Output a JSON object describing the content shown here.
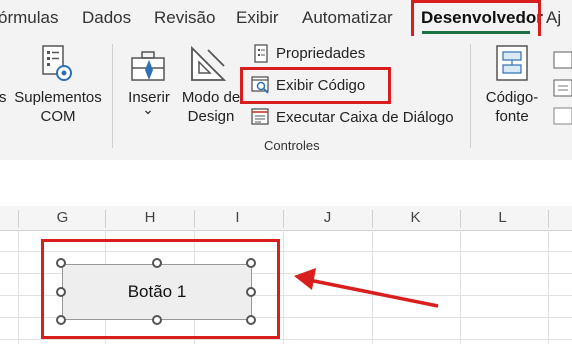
{
  "ribbon_tabs": [
    "órmulas",
    "Dados",
    "Revisão",
    "Exibir",
    "Automatizar",
    "Desenvolvedor",
    "Aj"
  ],
  "active_tab": "Desenvolvedor",
  "ribbon": {
    "suplementos_prefix": "s",
    "suplementos_com": [
      "Suplementos",
      "COM"
    ],
    "inserir": "Inserir",
    "inserir_chevron": "⌄",
    "modo_design": [
      "Modo de",
      "Design"
    ],
    "propriedades": "Propriedades",
    "exibir_codigo": "Exibir Código",
    "executar_caixa": "Executar Caixa de Diálogo",
    "controles_group": "Controles",
    "codigo_fonte": [
      "Código-",
      "fonte"
    ]
  },
  "columns": [
    "G",
    "H",
    "I",
    "J",
    "K",
    "L"
  ],
  "form_button": {
    "label": "Botão 1"
  },
  "colors": {
    "highlight": "#d91e1e",
    "accent": "#1e7145"
  }
}
